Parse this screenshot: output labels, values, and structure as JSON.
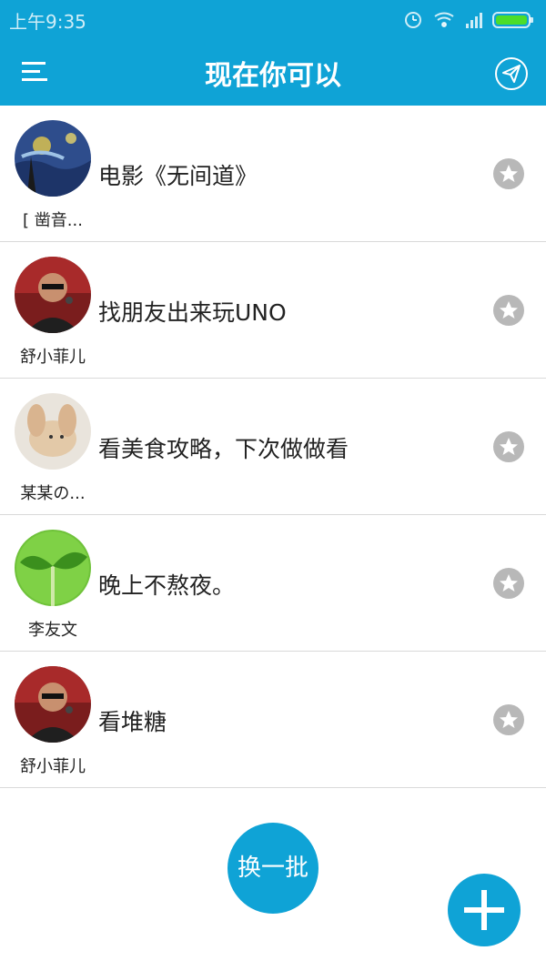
{
  "status": {
    "time": "上午9:35"
  },
  "appbar": {
    "title": "现在你可以"
  },
  "items": [
    {
      "avatar": "starry-night-avatar",
      "user": "[ 凿音...",
      "text": "电影《无间道》"
    },
    {
      "avatar": "singer-avatar",
      "user": "舒小菲儿",
      "text": "找朋友出来玩UNO"
    },
    {
      "avatar": "rabbit-avatar",
      "user": "某某の...",
      "text": "看美食攻略，下次做做看"
    },
    {
      "avatar": "sprout-avatar",
      "user": "李友文",
      "text": "晚上不熬夜。"
    },
    {
      "avatar": "singer-avatar",
      "user": "舒小菲儿",
      "text": "看堆糖"
    }
  ],
  "actions": {
    "refresh_label": "换一批"
  },
  "colors": {
    "primary": "#0fa3d6",
    "star_gray": "#b8b8b8",
    "divider": "#d9d9d9"
  }
}
